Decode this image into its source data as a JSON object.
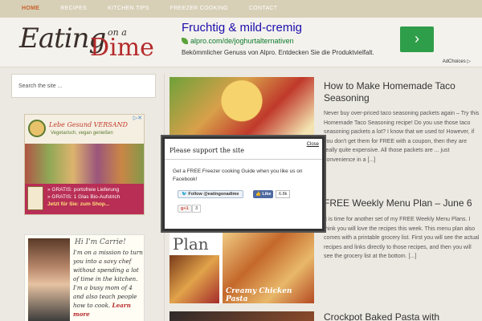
{
  "nav": {
    "items": [
      "HOME",
      "RECIPES",
      "KITCHEN TIPS",
      "FREEZER COOKING",
      "CONTACT"
    ]
  },
  "logo": {
    "eating": "Eating",
    "on_a": "on a",
    "dime": "Dime"
  },
  "header_ad": {
    "title": "Fruchtig & mild-cremig",
    "url": "alpro.com/de/joghurtalternativen",
    "description": "Bekömmlicher Genuss von Alpro. Entdecken Sie die Produktvielfalt.",
    "button": "›",
    "adchoices": "AdChoices ▷"
  },
  "sidebar": {
    "search_placeholder": "Search the site ...",
    "ad": {
      "brand_title": "Lebe Gesund VERSAND",
      "brand_sub": "Vegetarisch, vegan genießen",
      "promo_line1": "» GRATIS: portofreie Lieferung",
      "promo_line2": "» GRATIS: 1 Glas Bio-Aufstrich",
      "promo_link": "Jetzt für Sie: zum Shop...",
      "close": "▷✕"
    },
    "about": {
      "hi": "Hi I'm Carrie!",
      "bio": "I'm on a mission to turn you into a savy chef without spending a lot of time in the kitchen. I'm a busy mom of 4 and also teach people how to cook.",
      "learn_more": "Learn more"
    }
  },
  "posts": [
    {
      "title": "How to Make Homemade Taco Seasoning",
      "excerpt": "Never buy over-priced taco seasoning packets again – Try this Homemade Taco Seasoning recipe! Do you use those taco seasoning packets a lot? I know that we used to! However, if you don't get them for FREE with a coupon, then they are really quite expensive. All those packets are ... just convenience in a [...]"
    },
    {
      "title": "FREE Weekly Menu Plan – June 6",
      "excerpt": "It is time for another set of my FREE Weekly Menu Plans. I think you will love the recipes this week. This menu plan also comes with a printable grocery list. First you will see the actual recipes and links directly to those recipes, and then you will see the grocery list at the bottom. [...]",
      "thumb_plan": "Plan",
      "thumb_caption": "Creamy Chicken Pasta"
    },
    {
      "title": "Crockpot Baked Pasta with"
    }
  ],
  "modal": {
    "title": "Please support the site",
    "close": "Close",
    "text": "Get a FREE Freezer cooking Guide when you like us on Facebook!",
    "twitter_follow": "🐦 Follow @eatingonadime",
    "fb_like": "👍 Like",
    "fb_count": "6.8k",
    "gplus": "g+1",
    "gplus_count": "3"
  }
}
